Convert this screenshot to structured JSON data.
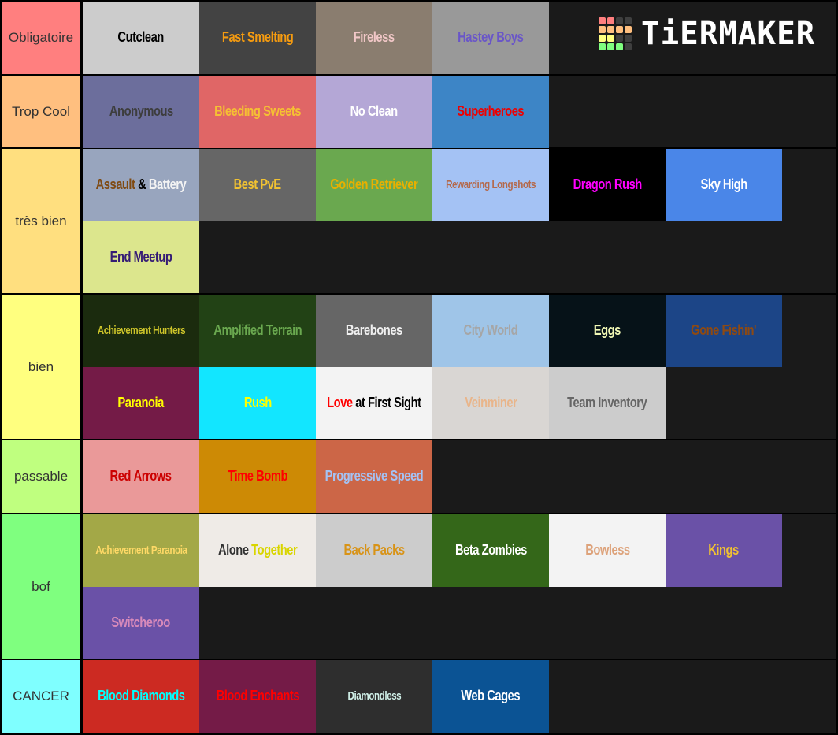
{
  "logo": {
    "text": "TiERMAKER",
    "grid_colors": [
      "#ff7f7f",
      "#ff7f7f",
      "#3f3f3f",
      "#3f3f3f",
      "#ffbf7f",
      "#ffbf7f",
      "#ffbf7f",
      "#ffbf7f",
      "#ffff7f",
      "#ffff7f",
      "#3f3f3f",
      "#3f3f3f",
      "#7fff7f",
      "#7fff7f",
      "#7fff7f",
      "#3f3f3f"
    ]
  },
  "tiers": [
    {
      "label": "Obligatoire",
      "color": "#ff7f7f",
      "items": [
        {
          "parts": [
            {
              "text": "Cutclean",
              "color": "#000000"
            }
          ],
          "bg": "#cccccc"
        },
        {
          "parts": [
            {
              "text": "Fast Smelting",
              "color": "#f59b10"
            }
          ],
          "bg": "#434343"
        },
        {
          "parts": [
            {
              "text": "Fireless",
              "color": "#f1c7c7"
            }
          ],
          "bg": "#8a7d6f"
        },
        {
          "parts": [
            {
              "text": "Hastey Boys",
              "color": "#6a56c8"
            }
          ],
          "bg": "#999999"
        }
      ]
    },
    {
      "label": "Trop Cool",
      "color": "#ffbf7f",
      "items": [
        {
          "parts": [
            {
              "text": "Anonymous",
              "color": "#3d3d3d"
            }
          ],
          "bg": "#6c6e9c"
        },
        {
          "parts": [
            {
              "text": "Bleeding Sweets",
              "color": "#f5c033"
            }
          ],
          "bg": "#e06666"
        },
        {
          "parts": [
            {
              "text": "No Clean",
              "color": "#ffffff"
            }
          ],
          "bg": "#b4a7d6"
        },
        {
          "parts": [
            {
              "text": "Superheroes",
              "color": "#ee0000"
            }
          ],
          "bg": "#3d85c6"
        }
      ]
    },
    {
      "label": "très bien",
      "color": "#ffdf7f",
      "items": [
        {
          "parts": [
            {
              "text": "Assault",
              "color": "#7f4a12"
            },
            {
              "text": " & ",
              "color": "#000000"
            },
            {
              "text": "Battery",
              "color": "#f3f3f3"
            }
          ],
          "bg": "#98a5be"
        },
        {
          "parts": [
            {
              "text": "Best PvE",
              "color": "#f1c232"
            }
          ],
          "bg": "#666666"
        },
        {
          "parts": [
            {
              "text": "Golden Retriever",
              "color": "#e7b000"
            }
          ],
          "bg": "#6aa84f"
        },
        {
          "parts": [
            {
              "text": "Rewarding Longshots",
              "color": "#b4694b"
            }
          ],
          "bg": "#a4c2f4",
          "small": true
        },
        {
          "parts": [
            {
              "text": "Dragon Rush",
              "color": "#ff00ff"
            }
          ],
          "bg": "#000000"
        },
        {
          "parts": [
            {
              "text": "Sky High",
              "color": "#ffffff"
            }
          ],
          "bg": "#4a86e8"
        },
        {
          "parts": [
            {
              "text": "End Meetup",
              "color": "#351c75"
            }
          ],
          "bg": "#dce68d"
        }
      ]
    },
    {
      "label": "bien",
      "color": "#ffff7f",
      "items": [
        {
          "parts": [
            {
              "text": "Achievement Hunters",
              "color": "#cdc42a"
            }
          ],
          "bg": "#1b2b0e",
          "small": true
        },
        {
          "parts": [
            {
              "text": "Amplified Terrain",
              "color": "#6aa84f"
            }
          ],
          "bg": "#224215"
        },
        {
          "parts": [
            {
              "text": "Barebones",
              "color": "#efefef"
            }
          ],
          "bg": "#666666"
        },
        {
          "parts": [
            {
              "text": "City World",
              "color": "#a6a6a6"
            }
          ],
          "bg": "#9fc5e8"
        },
        {
          "parts": [
            {
              "text": "Eggs",
              "color": "#f0f7b4"
            }
          ],
          "bg": "#061218"
        },
        {
          "parts": [
            {
              "text": "Gone Fishin'",
              "color": "#8f4a12"
            }
          ],
          "bg": "#1c4587"
        },
        {
          "parts": [
            {
              "text": "Paranoia",
              "color": "#ffff00"
            }
          ],
          "bg": "#741b47"
        },
        {
          "parts": [
            {
              "text": "Rush",
              "color": "#ffff00"
            }
          ],
          "bg": "#12e6ff"
        },
        {
          "parts": [
            {
              "text": "Love",
              "color": "#ff0000"
            },
            {
              "text": " at First Sight",
              "color": "#000000"
            }
          ],
          "bg": "#f3f3f3"
        },
        {
          "parts": [
            {
              "text": "Veinminer",
              "color": "#e9b58a"
            }
          ],
          "bg": "#d9d6d3"
        },
        {
          "parts": [
            {
              "text": "Team Inventory",
              "color": "#666666"
            }
          ],
          "bg": "#cccccc"
        }
      ]
    },
    {
      "label": "passable",
      "color": "#bfff7f",
      "items": [
        {
          "parts": [
            {
              "text": "Red Arrows",
              "color": "#cc0000"
            }
          ],
          "bg": "#ea9999"
        },
        {
          "parts": [
            {
              "text": "Time Bomb",
              "color": "#ff0000"
            }
          ],
          "bg": "#cd8a05"
        },
        {
          "parts": [
            {
              "text": "Progressive Speed",
              "color": "#a4c2f4"
            }
          ],
          "bg": "#cc6647"
        }
      ]
    },
    {
      "label": "bof",
      "color": "#7fff7f",
      "items": [
        {
          "parts": [
            {
              "text": "Achievement Paranoia",
              "color": "#ffd966"
            }
          ],
          "bg": "#a3a847",
          "small": true
        },
        {
          "parts": [
            {
              "text": "Alone",
              "color": "#333333"
            },
            {
              "text": " Together",
              "color": "#d9d500"
            }
          ],
          "bg": "#efebe7"
        },
        {
          "parts": [
            {
              "text": "Back Packs",
              "color": "#d89317"
            }
          ],
          "bg": "#cccccc"
        },
        {
          "parts": [
            {
              "text": "Beta Zombies",
              "color": "#ffffff"
            }
          ],
          "bg": "#346719"
        },
        {
          "parts": [
            {
              "text": "Bowless",
              "color": "#dda27a"
            }
          ],
          "bg": "#f3f3f3"
        },
        {
          "parts": [
            {
              "text": "Kings",
              "color": "#f1c232"
            }
          ],
          "bg": "#6a51a7"
        },
        {
          "parts": [
            {
              "text": "Switcheroo",
              "color": "#d88aba"
            }
          ],
          "bg": "#6a51a7"
        }
      ]
    },
    {
      "label": "CANCER",
      "color": "#7fffff",
      "items": [
        {
          "parts": [
            {
              "text": "Blood Diamonds",
              "color": "#00ffff"
            }
          ],
          "bg": "#cc2a22"
        },
        {
          "parts": [
            {
              "text": "Blood Enchants",
              "color": "#ff0000"
            }
          ],
          "bg": "#741b47"
        },
        {
          "parts": [
            {
              "text": "Diamondless",
              "color": "#d0f0e8"
            }
          ],
          "bg": "#2e2e2e",
          "small": true
        },
        {
          "parts": [
            {
              "text": "Web Cages",
              "color": "#ffffff"
            }
          ],
          "bg": "#0b5394"
        }
      ]
    }
  ]
}
